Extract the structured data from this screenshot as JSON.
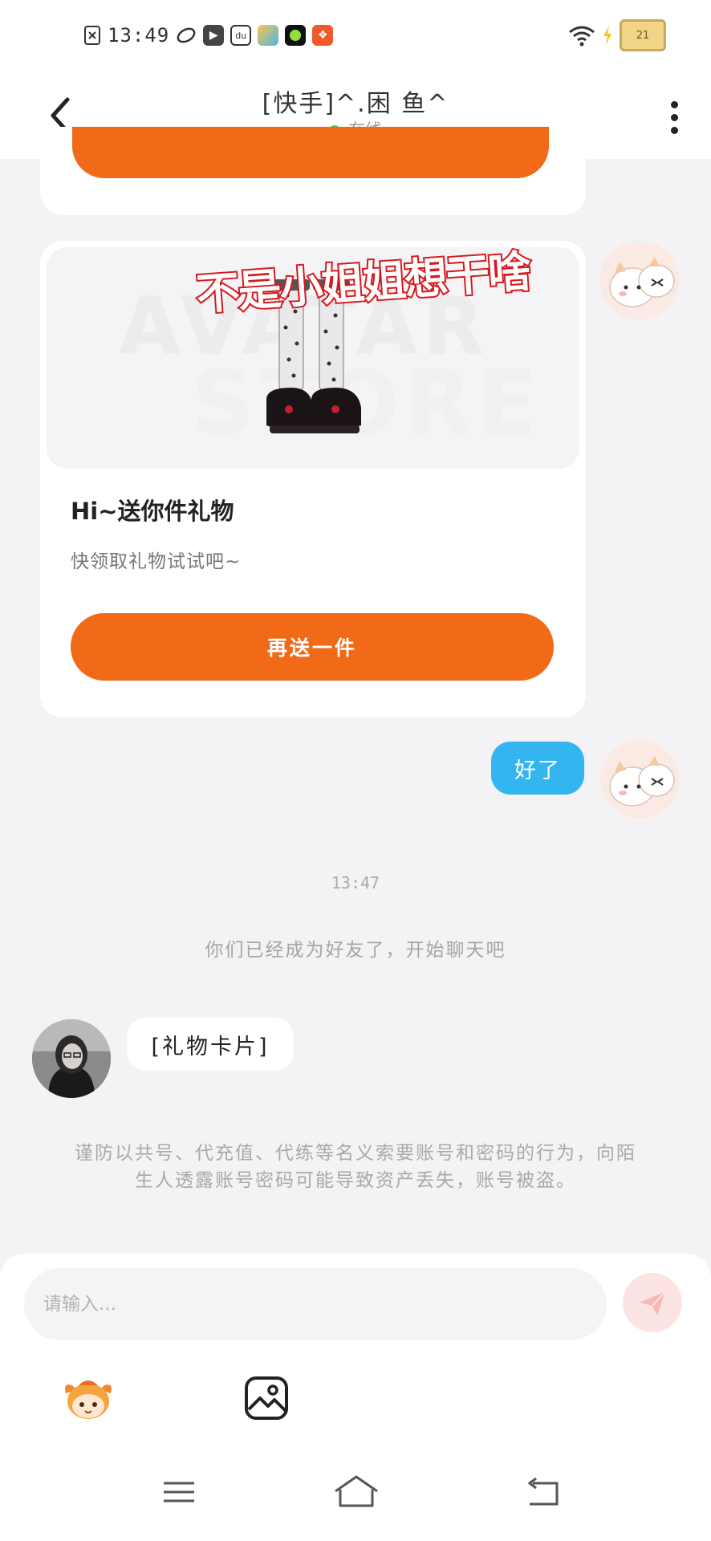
{
  "status_bar": {
    "time": "13:49",
    "battery_level": "21",
    "icons": [
      "no-sim-icon",
      "leaf-app-icon",
      "video-app-icon",
      "du-app-icon",
      "game-app-icon",
      "green-dot-app-icon",
      "orange-app-icon",
      "wifi-icon",
      "charging-icon",
      "battery-icon"
    ]
  },
  "header": {
    "title": "[快手]^.困 鱼^",
    "status": "在线"
  },
  "gift_card": {
    "sticker_text": "不是小姐姐想干啥",
    "watermark_line1": "AVATAR",
    "watermark_line2": "STORE",
    "title": "Hi~送你件礼物",
    "subtitle": "快领取礼物试试吧~",
    "button_label": "再送一件"
  },
  "messages": {
    "self_reply": "好了",
    "timestamp": "13:47",
    "friend_notice": "你们已经成为好友了，开始聊天吧",
    "other_card": "[礼物卡片]",
    "warning": "谨防以共号、代充值、代练等名义索要账号和密码的行为，向陌生人透露账号密码可能导致资产丢失，账号被盗。"
  },
  "composer": {
    "placeholder": "请输入..."
  },
  "colors": {
    "accent_orange": "#f06a17",
    "bubble_blue": "#33b5f0",
    "online_green": "#3ed04d"
  }
}
